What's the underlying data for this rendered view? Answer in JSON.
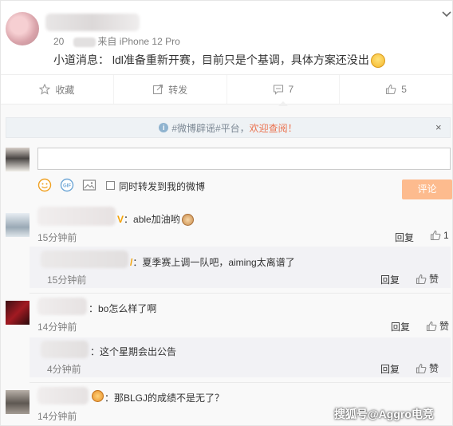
{
  "post": {
    "meta_tail": "来自 iPhone 12 Pro",
    "meta_prefix": "20",
    "text": "小道消息： ldl准备重新开赛，目前只是个基调，具体方案还没出"
  },
  "actions": {
    "favorite": "收藏",
    "repost": "转发",
    "comment_count": "7",
    "like_count": "5"
  },
  "notice": {
    "tag": "#微博辟谣#平台，",
    "link": "欢迎查阅！",
    "close": "×"
  },
  "compose": {
    "input_value": "",
    "also_repost": "同时转发到我的微博",
    "submit": "评论"
  },
  "comments": [
    {
      "text": "：able加油哟",
      "vip": "V",
      "time": "15分钟前",
      "reply": "回复",
      "like": "1"
    },
    {
      "text": "：夏季赛上调一队吧，aiming太离谱了",
      "vip": "/",
      "time": "15分钟前",
      "reply": "回复",
      "like": "赞"
    },
    {
      "text": "：bo怎么样了啊",
      "time": "14分钟前",
      "reply": "回复",
      "like": "赞"
    },
    {
      "text": "：这个星期会出公告",
      "time": "4分钟前",
      "reply": "回复",
      "like": "赞"
    },
    {
      "text": "：那BLGJ的成绩不是无了？",
      "time": "14分钟前"
    }
  ],
  "watermark": "搜狐号@Aggro电竞",
  "colors": {
    "accent": "#eb7350",
    "submit_bg": "#fdbb8e",
    "vip": "#f5a100"
  }
}
